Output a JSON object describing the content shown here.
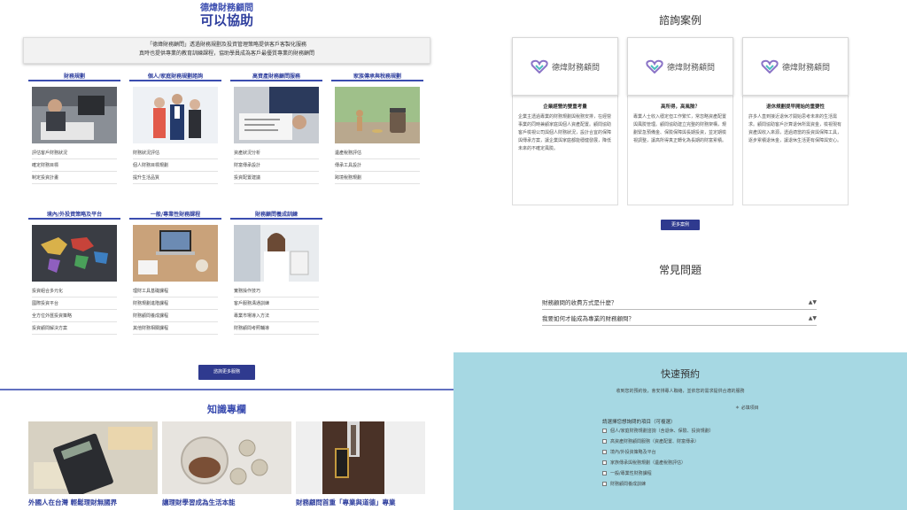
{
  "left": {
    "brand": "德煒財務顧問",
    "title": "可以協助",
    "intro_line1": "「德煒財務顧問」透過財務規劃及投資管理策略提供客戶客製化服務",
    "intro_line2": "真時也提供專業的教育訓練課程，協助學員成為客戶最優質專業的財務顧問",
    "services": [
      {
        "title": "財務規劃",
        "links": [
          "評估客戶財務狀況",
          "確定財務目標",
          "制定投資計畫"
        ]
      },
      {
        "title": "個人/家庭財務規劃諮詢",
        "links": [
          "財務狀況評估",
          "個人財務目標規劃",
          "提升生活品質"
        ]
      },
      {
        "title": "高資產財務顧問服務",
        "links": [
          "資產狀況分析",
          "財富傳承設計",
          "投資配置建議"
        ]
      },
      {
        "title": "家族傳承與稅務規劃",
        "links": [
          "遺產稅務評估",
          "傳承工具設計",
          "跨境稅務規劃"
        ]
      },
      {
        "title": "境內/外投資策略及平台",
        "links": [
          "投資組合多元化",
          "國際投資平台",
          "全方位外匯投資策略",
          "投資顧問解決方案"
        ]
      },
      {
        "title": "一般/專業性財務課程",
        "links": [
          "理財工具基礎課程",
          "財務規劃進階課程",
          "財務顧問養成課程",
          "其他財務相關課程"
        ]
      },
      {
        "title": "財務顧問養成訓練",
        "links": [
          "實務操作技巧",
          "客戶服務溝通訓練",
          "專業市場導入方法",
          "財務顧問考照輔導"
        ]
      }
    ],
    "more_services_button": "諮詢更多服務",
    "knowledge_title": "知識專欄",
    "articles": [
      "外國人在台灣 輕鬆理財無國界",
      "讓理財學習成為生活本能",
      "財務顧問首重「專業與道德」專業"
    ]
  },
  "right": {
    "cases_title": "諮詢案例",
    "cases": [
      {
        "logo": "德煒財務顧問",
        "title": "企業經營的雙重考量",
        "body": "企業主透過專業的財務規劃與稅務安排，在經營事業的同時兼顧家庭與個人資產配置。顧問協助客戶檢視公司與個人財務狀況，設計合宜的保障與傳承方案，讓企業與家庭都能穩健發展，降低未來的不確定風險。"
      },
      {
        "logo": "德煒財務顧問",
        "title": "高所得，高風險？",
        "body": "專業人士收入穩定但工作繁忙，常忽略資產配置與風險管理。顧問協助建立完整的財務架構，規劃緊急預備金、保險保障與長期投資，並定期檢視調整，讓高所得真正轉化為長期的財富累積。"
      },
      {
        "logo": "德煒財務顧問",
        "title": "退休規劃提早開始的重要性",
        "body": "許多人直到接近退休才開始思考未來的生活需求。顧問協助客戶計算退休所需資金，檢視現有資產與收入來源，透過適當的投資與保障工具，逐步累積退休金，讓退休生活更有保障與安心。"
      }
    ],
    "more_cases_button": "更多案例",
    "faq_title": "常見問題",
    "faqs": [
      "財務顧問的收費方式是什麼？",
      "我要如何才能成為專業的財務顧問？"
    ],
    "booking": {
      "title": "快速預約",
      "desc": "收到您的預約後，會安排專人聯絡，並依您的需求提供合適的服務",
      "required_note": "＊ 必填項目",
      "question": "請選擇您想詢問的項目（可複選）",
      "options": [
        "個人/家庭財務規劃諮詢（含退休、保險、投資規劃）",
        "高資產財務顧問服務（資產配置、財富傳承）",
        "境內/外投資策略及平台",
        "家族傳承與稅務規劃（遺產稅務評估）",
        "一般/專業性財務課程",
        "財務顧問養成訓練"
      ]
    }
  },
  "colors": {
    "brand": "#2f3f9e",
    "button": "#2f3a8f",
    "booking_bg": "#a6d8e3"
  }
}
